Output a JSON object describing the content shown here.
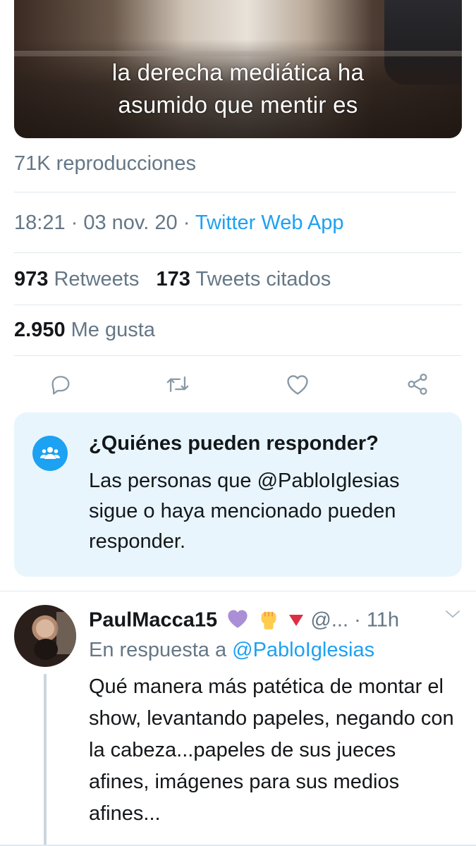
{
  "video": {
    "caption_line1": "la derecha mediática ha",
    "caption_line2": "asumido que mentir es"
  },
  "views_text": "71K reproducciones",
  "meta": {
    "time": "18:21",
    "sep1": " · ",
    "date": "03 nov. 20",
    "sep2": " · ",
    "source": "Twitter Web App"
  },
  "stats": {
    "retweets_count": "973",
    "retweets_label": "Retweets",
    "quotes_count": "173",
    "quotes_label": "Tweets citados",
    "likes_count": "2.950",
    "likes_label": "Me gusta"
  },
  "actions": {
    "icons": [
      "reply-icon",
      "retweet-icon",
      "like-icon",
      "share-icon"
    ]
  },
  "reply_settings": {
    "title": "¿Quiénes pueden responder?",
    "body": "Las personas que @PabloIglesias sigue o haya mencionado pueden responder."
  },
  "reply": {
    "name": "PaulMacca15",
    "emojis": [
      "purple-heart-icon",
      "raised-fist-icon",
      "red-triangle-down-icon"
    ],
    "handle": "@...",
    "time": "· 11h",
    "in_reply_prefix": "En respuesta a ",
    "in_reply_mention": "@PabloIglesias",
    "text": "Qué manera más patética de montar el show, levantando papeles, negando con la cabeza...papeles de sus jueces afines, imágenes para sus medios afines..."
  },
  "colors": {
    "accent": "#1da1f2",
    "secondary_text": "#657786",
    "primary_text": "#14171a",
    "card_bg": "#e8f5fd",
    "divider": "#e1e8ed"
  }
}
